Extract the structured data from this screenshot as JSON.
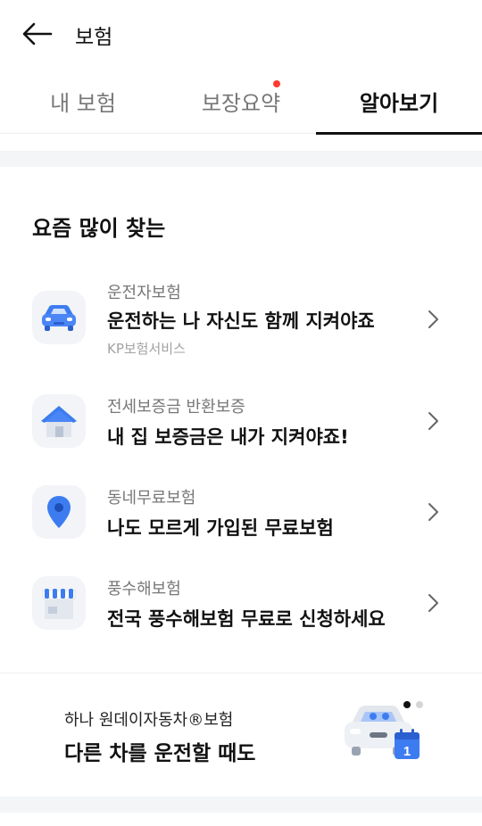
{
  "header": {
    "title": "보험",
    "back_icon": "arrow-left-icon"
  },
  "tabs": [
    {
      "label": "내 보험",
      "active": false,
      "badge": false
    },
    {
      "label": "보장요약",
      "active": false,
      "badge": true
    },
    {
      "label": "알아보기",
      "active": true,
      "badge": false
    }
  ],
  "section": {
    "title": "요즘 많이 찾는"
  },
  "items": [
    {
      "category": "운전자보험",
      "title": "운전하는 나 자신도 함께 지켜야죠",
      "provider": "KP보험서비스",
      "icon": "car-icon"
    },
    {
      "category": "전세보증금 반환보증",
      "title": "내 집 보증금은 내가 지켜야죠!",
      "provider": "",
      "icon": "house-icon"
    },
    {
      "category": "동네무료보험",
      "title": "나도 모르게 가입된 무료보험",
      "provider": "",
      "icon": "location-pin-icon"
    },
    {
      "category": "풍수해보험",
      "title": "전국 풍수해보험 무료로 신청하세요",
      "provider": "",
      "icon": "storefront-icon"
    }
  ],
  "banner": {
    "subtitle": "하나 원데이자동차®보험",
    "title": "다른 차를 운전할 때도",
    "page_current": 1,
    "page_total": 2,
    "art_icon": "car-calendar-icon",
    "calendar_day": "1"
  },
  "colors": {
    "accent_blue": "#3d7cf0",
    "badge_red": "#ff3b30",
    "icon_bg": "#f2f4f7",
    "band_gray": "#f4f5f7"
  }
}
